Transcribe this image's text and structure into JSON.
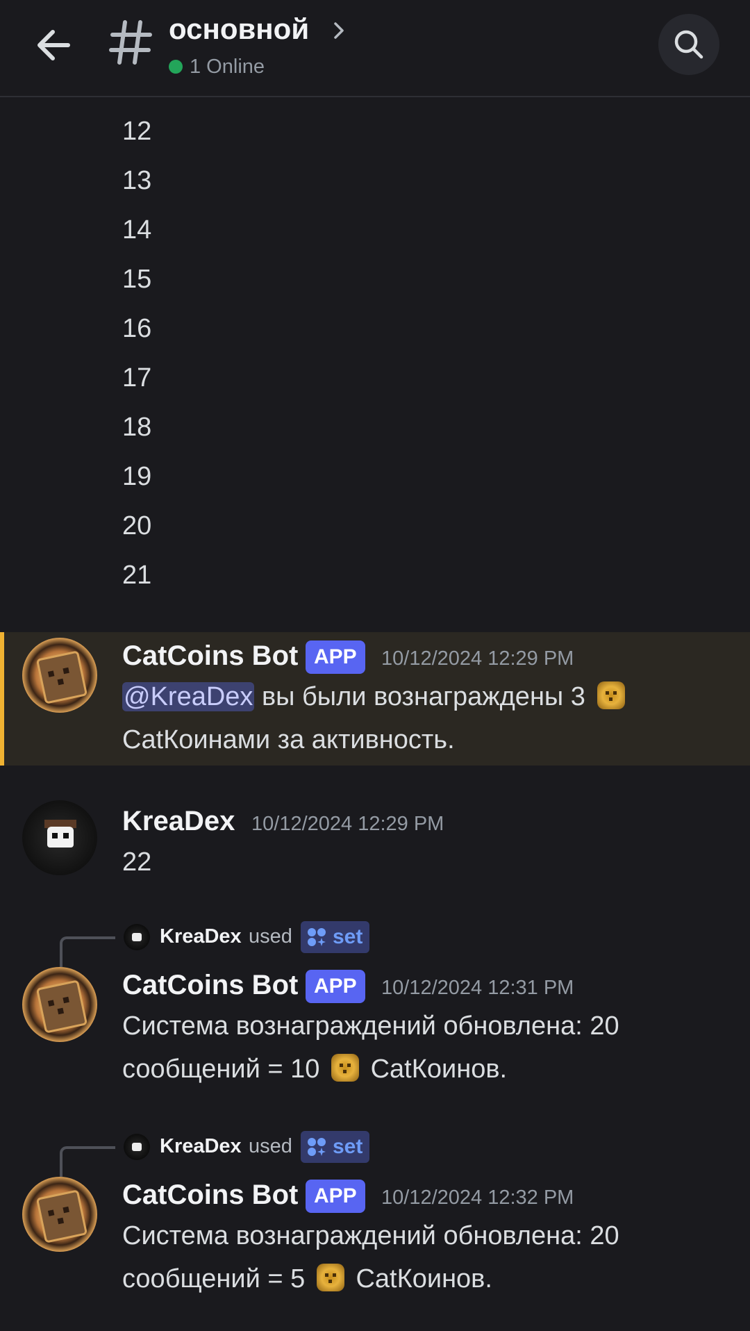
{
  "header": {
    "channel_name": "основной",
    "online_text": "1 Online",
    "icons": [
      "back-arrow-icon",
      "hash-icon",
      "chevron-right-icon",
      "search-icon"
    ]
  },
  "number_lines": [
    "12",
    "13",
    "14",
    "15",
    "16",
    "17",
    "18",
    "19",
    "20",
    "21"
  ],
  "messages": [
    {
      "author": "CatCoins Bot",
      "badge": "APP",
      "timestamp": "10/12/2024 12:29 PM",
      "mention": "@KreaDex",
      "line1_rest": "вы были вознаграждены 3",
      "line2": "CatКоинами за активность."
    },
    {
      "author": "KreaDex",
      "timestamp": "10/12/2024 12:29 PM",
      "body": "22"
    },
    {
      "cmd_user": "KreaDex",
      "cmd_used": "used",
      "cmd_name": "set",
      "author": "CatCoins Bot",
      "badge": "APP",
      "timestamp": "10/12/2024 12:31 PM",
      "line1": "Система вознаграждений обновлена: 20",
      "line2_pre": "сообщений = 10",
      "line2_post": "CatКоинов."
    },
    {
      "cmd_user": "KreaDex",
      "cmd_used": "used",
      "cmd_name": "set",
      "author": "CatCoins Bot",
      "badge": "APP",
      "timestamp": "10/12/2024 12:32 PM",
      "line1": "Система вознаграждений обновлена: 20",
      "line2_pre": "сообщений = 5",
      "line2_post": "CatКоинов."
    }
  ],
  "colors": {
    "background": "#1a1a1e",
    "highlight_bg": "#2b2822",
    "highlight_bar": "#f0b232",
    "app_badge": "#5865f2",
    "online_dot": "#23a55a",
    "command_pill": "#333a6b"
  }
}
